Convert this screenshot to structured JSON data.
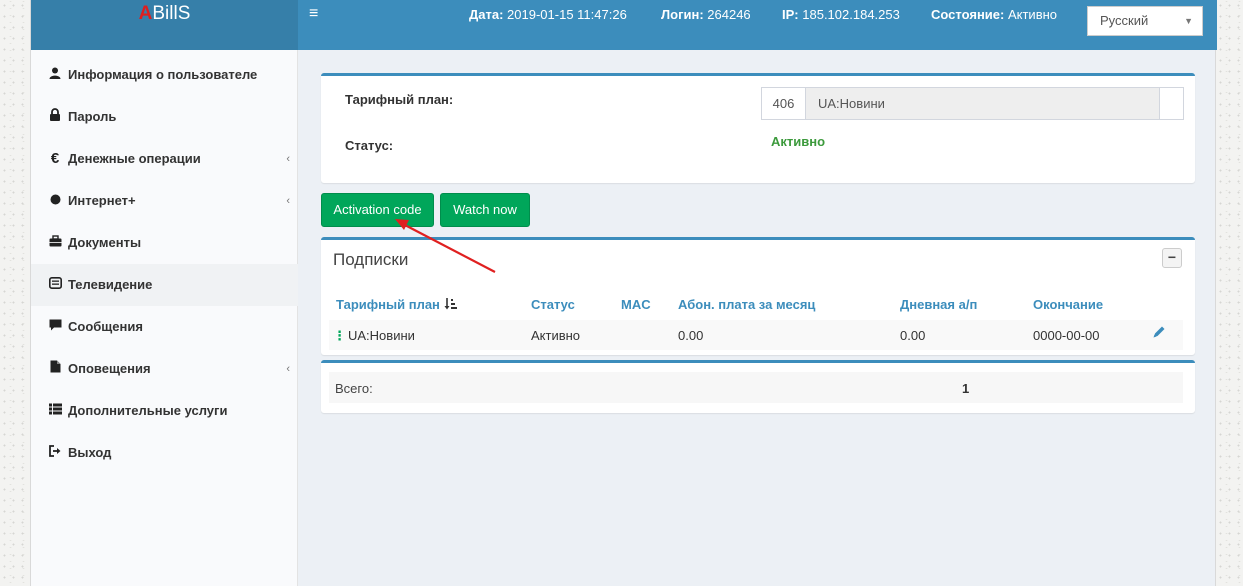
{
  "header": {
    "logo_a": "A",
    "logo_rest": "BillS",
    "menu_icon": "hamburger-icon",
    "date_label": "Дата:",
    "date_value": "2019-01-15 11:47:26",
    "login_label": "Логин:",
    "login_value": "264246",
    "ip_label": "IP:",
    "ip_value": "185.102.184.253",
    "state_label": "Состояние:",
    "state_value": "Активно",
    "language": "Русский"
  },
  "sidebar": {
    "items": [
      {
        "label": "Информация о пользователе",
        "icon": "user-icon",
        "submenu": false
      },
      {
        "label": "Пароль",
        "icon": "lock-icon",
        "submenu": false
      },
      {
        "label": "Денежные операции",
        "icon": "euro-icon",
        "submenu": true
      },
      {
        "label": "Интернет+",
        "icon": "circle-icon",
        "submenu": true
      },
      {
        "label": "Документы",
        "icon": "briefcase-icon",
        "submenu": false
      },
      {
        "label": "Телевидение",
        "icon": "tv-icon",
        "submenu": false,
        "active": true
      },
      {
        "label": "Сообщения",
        "icon": "comment-icon",
        "submenu": false
      },
      {
        "label": "Оповещения",
        "icon": "file-icon",
        "submenu": true
      },
      {
        "label": "Дополнительные услуги",
        "icon": "list-icon",
        "submenu": false
      },
      {
        "label": "Выход",
        "icon": "sign-out-icon",
        "submenu": false
      }
    ],
    "chevron": "‹"
  },
  "plan_box": {
    "plan_label": "Тарифный план:",
    "plan_id": "406",
    "plan_name": "UA:Новини",
    "status_label": "Статус:",
    "status_value": "Активно"
  },
  "buttons": {
    "activation": "Activation code",
    "watch": "Watch now"
  },
  "subscriptions": {
    "title": "Подписки",
    "collapse": "−",
    "columns": [
      "Тарифный план",
      "Статус",
      "MAC",
      "Абон. плата за месяц",
      "Дневная а/п",
      "Окончание"
    ],
    "sort_icon": "sort-icon",
    "rows": [
      {
        "plan": "UA:Новини",
        "status": "Активно",
        "mac": "",
        "monthly": "0.00",
        "daily": "0.00",
        "end": "0000-00-00"
      }
    ]
  },
  "totals": {
    "label": "Всего:",
    "value": "1"
  },
  "colors": {
    "header": "#3c8dbc",
    "logo_bg": "#367fa9",
    "button_green": "#00a65a",
    "active_status": "#3c9a3c",
    "arrow": "#e02020"
  }
}
